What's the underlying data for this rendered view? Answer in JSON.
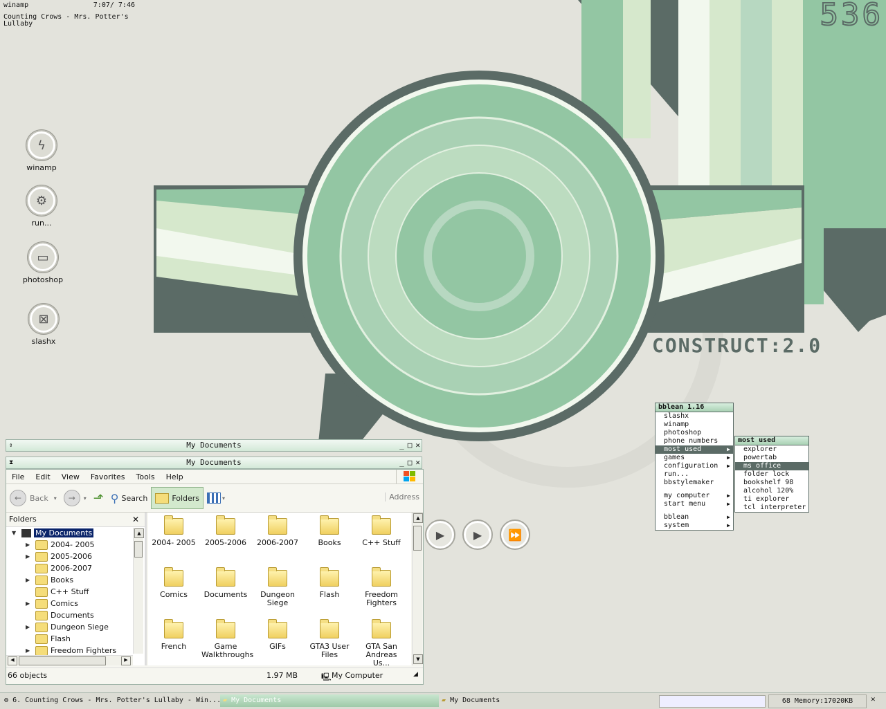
{
  "desktop": {
    "winamp_label": "winamp",
    "winamp_time": "7:07/ 7:46",
    "now_playing": "Counting Crows - Mrs. Potter's Lullaby",
    "clock": "536",
    "construct_logo": "CONSTRUCT:2.0",
    "icons": [
      {
        "label": "winamp",
        "icon": "lightning-icon"
      },
      {
        "label": "run...",
        "icon": "gear-icon"
      },
      {
        "label": "photoshop",
        "icon": "camera-icon"
      },
      {
        "label": "slashx",
        "icon": "slashx-icon"
      }
    ],
    "media": [
      "play",
      "play",
      "fast-forward"
    ],
    "colors": {
      "dark": "#5b6b66",
      "green": "#93c6a3",
      "light": "#d6e8cc",
      "bg": "#e3e3dc"
    }
  },
  "menu": {
    "title": "bblean 1.16",
    "items": [
      "slashx",
      "winamp",
      "photoshop",
      "phone numbers",
      "most used",
      "games",
      "configuration",
      "run...",
      "bbstylemaker",
      "my computer",
      "start menu",
      "bblean",
      "system"
    ],
    "submenu_title": "most used",
    "sub_items": [
      "explorer",
      "powertab",
      "ms office",
      "folder lock",
      "bookshelf 98",
      "alcohol 120%",
      "ti explorer",
      "tcl interpreter"
    ]
  },
  "explorer": {
    "back_title": "My Documents",
    "title": "My Documents",
    "menubar": [
      "File",
      "Edit",
      "View",
      "Favorites",
      "Tools",
      "Help"
    ],
    "toolbar": {
      "back": "Back",
      "search": "Search",
      "folders": "Folders",
      "address": "Address"
    },
    "folders_header": "Folders",
    "tree_root": "My Documents",
    "tree": [
      "2004- 2005",
      "2005-2006",
      "2006-2007",
      "Books",
      "C++ Stuff",
      "Comics",
      "Documents",
      "Dungeon Siege",
      "Flash",
      "Freedom Fighters"
    ],
    "files": [
      "2004- 2005",
      "2005-2006",
      "2006-2007",
      "Books",
      "C++ Stuff",
      "Comics",
      "Documents",
      "Dungeon Siege",
      "Flash",
      "Freedom Fighters",
      "French",
      "Game Walkthroughs",
      "GIFs",
      "GTA3 User Files",
      "GTA San Andreas Us..."
    ],
    "status": {
      "objects": "66 objects",
      "size": "1.97 MB",
      "location": "My Computer"
    }
  },
  "taskbar": {
    "tasks": [
      "6. Counting Crows - Mrs. Potter's Lullaby - Win...",
      "My Documents",
      "My Documents"
    ],
    "memory": "68 Memory:17020KB"
  }
}
